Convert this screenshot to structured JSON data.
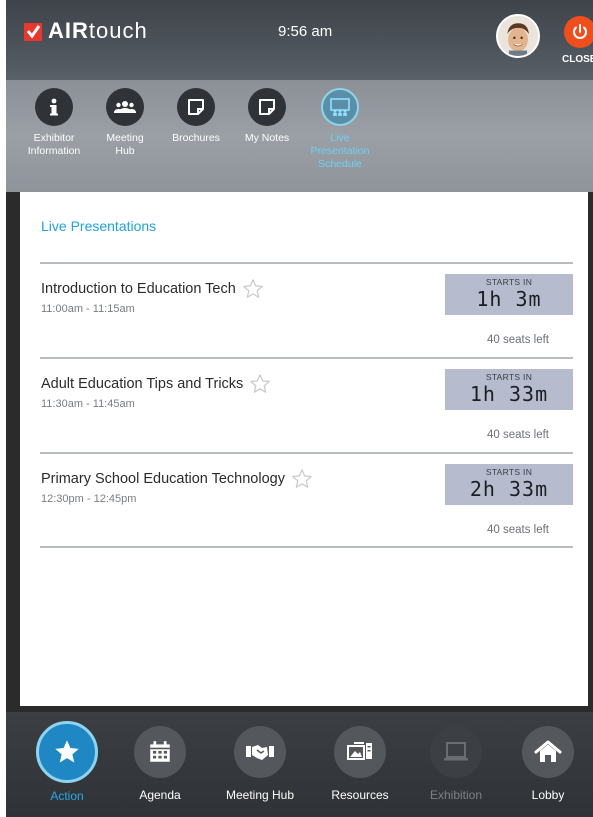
{
  "header": {
    "brand_air": "AIR",
    "brand_touch": "touch",
    "time": "9:56 am",
    "close_label": "CLOSE"
  },
  "subnav": {
    "items": [
      {
        "label": "Exhibitor\nInformation",
        "icon": "info-icon"
      },
      {
        "label": "Meeting\nHub",
        "icon": "people-icon"
      },
      {
        "label": "Brochures",
        "icon": "note-icon"
      },
      {
        "label": "My Notes",
        "icon": "note-icon"
      },
      {
        "label": "Live\nPresentation\nSchedule",
        "icon": "presentation-icon",
        "active": true
      }
    ]
  },
  "main": {
    "title": "Live Presentations",
    "presentations": [
      {
        "title": "Introduction to Education Tech",
        "time": "11:00am - 11:15am",
        "starts_label": "STARTS IN",
        "starts_in": "1h 3m",
        "seats": "40 seats left"
      },
      {
        "title": "Adult Education Tips and Tricks",
        "time": "11:30am - 11:45am",
        "starts_label": "STARTS IN",
        "starts_in": "1h 33m",
        "seats": "40 seats left"
      },
      {
        "title": "Primary School Education Technology",
        "time": "12:30pm - 12:45pm",
        "starts_label": "STARTS IN",
        "starts_in": "2h 33m",
        "seats": "40 seats left"
      }
    ]
  },
  "dock": {
    "items": [
      {
        "label": "Action",
        "icon": "star-icon",
        "active": true
      },
      {
        "label": "Agenda",
        "icon": "calendar-icon"
      },
      {
        "label": "Meeting Hub",
        "icon": "handshake-icon"
      },
      {
        "label": "Resources",
        "icon": "resources-icon"
      },
      {
        "label": "Exhibition",
        "icon": "monitor-icon",
        "disabled": true
      },
      {
        "label": "Lobby",
        "icon": "home-icon"
      }
    ]
  },
  "colors": {
    "accent": "#1fa3d8",
    "close": "#ef4e1d",
    "starts_box": "#b6bccd"
  }
}
